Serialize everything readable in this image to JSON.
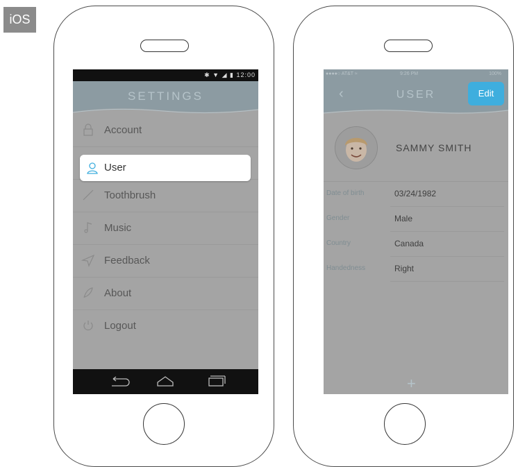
{
  "platform_label": "iOS",
  "android_screen": {
    "status_time": "12:00",
    "title": "SETTINGS",
    "menu": [
      {
        "label": "Account",
        "icon": "lock-icon"
      },
      {
        "label": "User",
        "icon": "user-icon",
        "selected": true
      },
      {
        "label": "Toothbrush",
        "icon": "toothbrush-icon"
      },
      {
        "label": "Music",
        "icon": "music-note-icon"
      },
      {
        "label": "Feedback",
        "icon": "paper-plane-icon"
      },
      {
        "label": "About",
        "icon": "feather-icon"
      },
      {
        "label": "Logout",
        "icon": "power-icon"
      }
    ]
  },
  "ios_screen": {
    "status_left": "●●●●○ AT&T ≈",
    "status_time": "9:26 PM",
    "status_right": "100%",
    "title": "USER",
    "edit_label": "Edit",
    "user_name": "SAMMY SMITH",
    "fields": [
      {
        "key": "Date of birth",
        "value": "03/24/1982"
      },
      {
        "key": "Gender",
        "value": "Male"
      },
      {
        "key": "Country",
        "value": "Canada"
      },
      {
        "key": "Handedness",
        "value": "Right"
      }
    ],
    "add_symbol": "+"
  },
  "colors": {
    "accent": "#3eaede",
    "overlay": "#a4a4a4",
    "header": "#8c9ba2"
  }
}
